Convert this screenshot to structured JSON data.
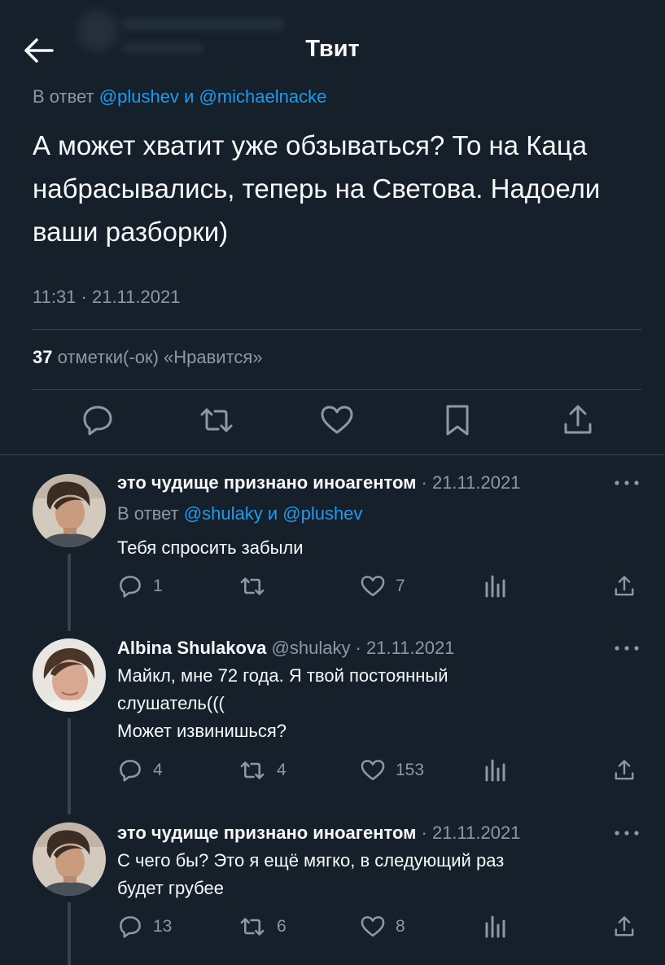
{
  "header": {
    "title": "Твит"
  },
  "tweet": {
    "reply_prefix": "В ответ",
    "reply_user1": "@plushev",
    "reply_and": "и",
    "reply_user2": "@michaelnacke",
    "text": "А может хватит уже обзываться? То на Каца набрасывались, теперь на Светова. Надоели ваши разборки)",
    "timestamp": "11:31 · 21.11.2021",
    "likes_count": "37",
    "likes_label": "отметки(-ок) «Нравится»"
  },
  "replies": [
    {
      "name": "это чудище признано иноагентом",
      "meta": "· 21.11.2021",
      "reply_prefix": "В ответ",
      "reply_user1": "@shulaky",
      "reply_and": "и",
      "reply_user2": "@plushev",
      "text": "Тебя спросить забыли",
      "replies": "1",
      "retweets": "",
      "likes": "7"
    },
    {
      "name": "Albina Shulakova",
      "meta": "@shulaky · 21.11.2021",
      "text_line1": "Майкл, мне 72 года. Я твой постоянный",
      "text_line2": "слушатель(((",
      "text_line3": "Может извинишься?",
      "replies": "4",
      "retweets": "4",
      "likes": "153"
    },
    {
      "name": "это чудище признано иноагентом",
      "meta": "· 21.11.2021",
      "text_line1": "С чего бы? Это я ещё мягко, в следующий раз",
      "text_line2": "будет грубее",
      "replies": "13",
      "retweets": "6",
      "likes": "8"
    }
  ],
  "colors": {
    "background": "#15202b",
    "link": "#1d9bf0",
    "muted": "#8b98a5",
    "divider": "#38444d"
  },
  "icons": [
    "back-arrow-icon",
    "reply-icon",
    "retweet-icon",
    "like-icon",
    "bookmark-icon",
    "share-icon",
    "analytics-icon",
    "more-icon"
  ]
}
